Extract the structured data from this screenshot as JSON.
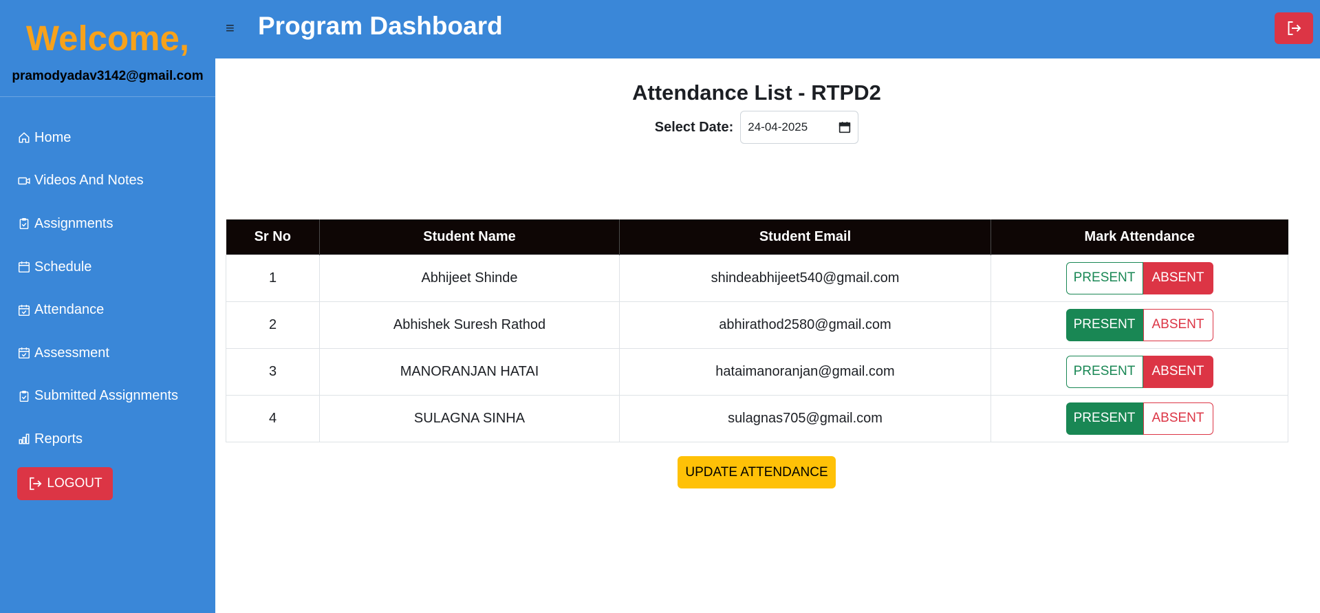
{
  "sidebar": {
    "welcome": "Welcome,",
    "email": "pramodyadav3142@gmail.com",
    "items": [
      {
        "label": "Home",
        "icon": "home-icon"
      },
      {
        "label": "Videos And Notes",
        "icon": "video-icon"
      },
      {
        "label": "Assignments",
        "icon": "clipboard-icon"
      },
      {
        "label": "Schedule",
        "icon": "calendar-icon"
      },
      {
        "label": "Attendance",
        "icon": "calendar-check-icon"
      },
      {
        "label": "Assessment",
        "icon": "calendar-check-icon"
      },
      {
        "label": "Submitted Assignments",
        "icon": "clipboard-icon"
      },
      {
        "label": "Reports",
        "icon": "bar-chart-icon"
      }
    ],
    "logout_label": "LOGOUT",
    "color": "#3a87d8"
  },
  "header": {
    "menu_icon": "≡",
    "title": "Program Dashboard",
    "exit_icon": "exit-icon"
  },
  "main": {
    "title": "Attendance List - RTPD2",
    "date_label": "Select Date:",
    "date_value": "24-04-2025",
    "columns": [
      "Sr No",
      "Student Name",
      "Student Email",
      "Mark Attendance"
    ],
    "present_label": "PRESENT",
    "absent_label": "ABSENT",
    "rows": [
      {
        "sr": "1",
        "name": "Abhijeet Shinde",
        "email": "shindeabhijeet540@gmail.com",
        "status": "absent"
      },
      {
        "sr": "2",
        "name": "Abhishek Suresh Rathod",
        "email": "abhirathod2580@gmail.com",
        "status": "present"
      },
      {
        "sr": "3",
        "name": "MANORANJAN HATAI",
        "email": "hataimanoranjan@gmail.com",
        "status": "absent"
      },
      {
        "sr": "4",
        "name": "SULAGNA SINHA",
        "email": "sulagnas705@gmail.com",
        "status": "present"
      }
    ],
    "update_label": "UPDATE ATTENDANCE"
  },
  "colors": {
    "accent": "#3a87d8",
    "welcome": "#f7a21b",
    "present": "#198754",
    "absent": "#dc3545",
    "update": "#ffc107",
    "table_header": "#0e0605"
  }
}
